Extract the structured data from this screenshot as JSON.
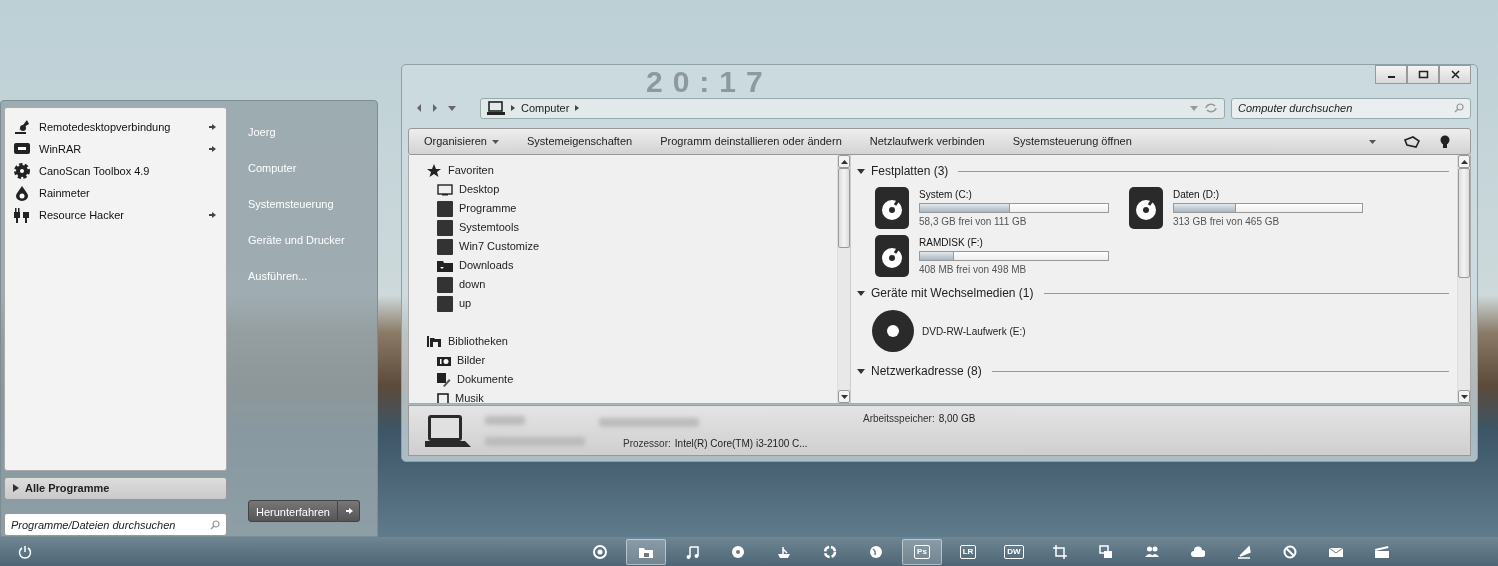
{
  "desktop": {
    "clock": "20:17"
  },
  "start_menu": {
    "programs": [
      {
        "name": "Remotedesktopverbindung",
        "submenu": true
      },
      {
        "name": "WinRAR",
        "submenu": true
      },
      {
        "name": "CanoScan Toolbox 4.9",
        "submenu": false
      },
      {
        "name": "Rainmeter",
        "submenu": false
      },
      {
        "name": "Resource Hacker",
        "submenu": true
      }
    ],
    "all_programs": "Alle Programme",
    "search": {
      "placeholder": "Programme/Dateien durchsuchen"
    },
    "places": [
      "Joerg",
      "Computer",
      "Systemsteuerung",
      "Geräte und Drucker",
      "Ausführen..."
    ],
    "shutdown": "Herunterfahren"
  },
  "explorer": {
    "breadcrumbs": [
      "Computer"
    ],
    "search": {
      "placeholder": "Computer durchsuchen"
    },
    "toolbar": [
      {
        "label": "Organisieren",
        "dropdown": true
      },
      {
        "label": "Systemeigenschaften",
        "dropdown": false
      },
      {
        "label": "Programm deinstallieren oder ändern",
        "dropdown": false
      },
      {
        "label": "Netzlaufwerk verbinden",
        "dropdown": false
      },
      {
        "label": "Systemsteuerung öffnen",
        "dropdown": false
      }
    ],
    "nav": [
      {
        "label": "Favoriten",
        "children": [
          {
            "label": "Desktop"
          },
          {
            "label": "Programme"
          },
          {
            "label": "Systemtools"
          },
          {
            "label": "Win7 Customize"
          },
          {
            "label": "Downloads"
          },
          {
            "label": "down"
          },
          {
            "label": "up"
          }
        ]
      },
      {
        "label": "Bibliotheken",
        "children": [
          {
            "label": "Bilder"
          },
          {
            "label": "Dokumente"
          },
          {
            "label": "Musik"
          }
        ]
      }
    ],
    "sections": [
      {
        "title": "Festplatten (3)",
        "kind": "drives",
        "items": [
          {
            "name": "System (C:)",
            "level": 0.48,
            "free": "58,3 GB frei von 111 GB"
          },
          {
            "name": "Daten (D:)",
            "level": 0.33,
            "free": "313 GB frei von 465 GB"
          },
          {
            "name": "RAMDISK (F:)",
            "level": 0.18,
            "free": "408 MB frei von 498 MB"
          }
        ]
      },
      {
        "title": "Geräte mit Wechselmedien (1)",
        "kind": "devices",
        "items": [
          {
            "name": "DVD-RW-Laufwerk (E:)"
          }
        ]
      },
      {
        "title": "Netzwerkadresse (8)",
        "kind": "network"
      }
    ],
    "details": {
      "memory_label": "Arbeitsspeicher:",
      "memory": "8,00 GB",
      "cpu_label": "Prozessor:",
      "cpu": "Intel(R) Core(TM) i3-2100 C..."
    }
  },
  "taskbar": {
    "items": [
      {
        "active": false
      },
      {
        "active": true
      },
      {
        "active": false
      },
      {
        "active": false
      },
      {
        "active": false
      },
      {
        "active": false
      },
      {
        "active": false
      },
      {
        "label": "Ps",
        "active": true
      },
      {
        "label": "LR",
        "active": false
      },
      {
        "label": "DW",
        "active": false
      },
      {
        "active": false
      },
      {
        "active": false
      },
      {
        "active": false
      },
      {
        "active": false
      },
      {
        "active": false
      },
      {
        "active": false
      },
      {
        "active": false
      },
      {
        "active": false
      }
    ]
  }
}
